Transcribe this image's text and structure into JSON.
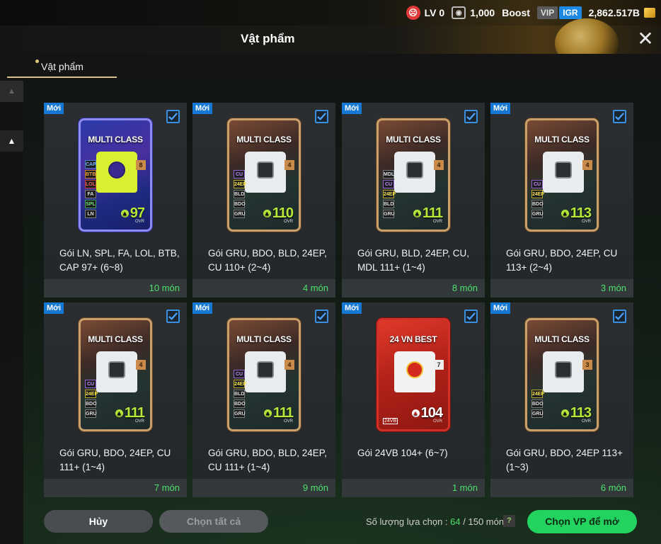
{
  "status_bar": {
    "level": "LV 0",
    "rank_points": "1,000",
    "boost_label": "Boost",
    "vip_label": "VIP",
    "igr_label": "IGR",
    "currency": "2,862.517B"
  },
  "header": {
    "title": "Vật phẩm"
  },
  "tabs": [
    {
      "label": "Vật phẩm",
      "active": true
    }
  ],
  "items": [
    {
      "badge": "Mới",
      "pack_style": "multi",
      "pack_title": "MULTI CLASS",
      "jersey_number": "8",
      "classes": [
        "CAP",
        "BTB",
        "LOL",
        "FA",
        "SPL",
        "LN"
      ],
      "ovr": "97",
      "ovr_label": "OVR",
      "name": "Gói LN, SPL, FA, LOL, BTB, CAP 97+ (6~8)",
      "count": "10 món",
      "checked": true
    },
    {
      "badge": "Mới",
      "pack_style": "mc",
      "pack_title": "MULTI CLASS",
      "jersey_number": "4",
      "classes": [
        "CU",
        "24EP",
        "BLD",
        "BDO",
        "GRU"
      ],
      "ovr": "110",
      "ovr_label": "OVR",
      "name": "Gói GRU, BDO, BLD, 24EP, CU 110+ (2~4)",
      "count": "4 món",
      "checked": true
    },
    {
      "badge": "Mới",
      "pack_style": "mc",
      "pack_title": "MULTI CLASS",
      "jersey_number": "4",
      "classes": [
        "MDL",
        "CU",
        "24EP",
        "BLD",
        "GRU"
      ],
      "ovr": "111",
      "ovr_label": "OVR",
      "name": "Gói GRU, BLD, 24EP, CU, MDL 111+ (1~4)",
      "count": "8 món",
      "checked": true
    },
    {
      "badge": "Mới",
      "pack_style": "mc",
      "pack_title": "MULTI CLASS",
      "jersey_number": "4",
      "classes": [
        "CU",
        "24EP",
        "BDO",
        "GRU"
      ],
      "ovr": "113",
      "ovr_label": "OVR",
      "name": "Gói GRU, BDO, 24EP, CU 113+ (2~4)",
      "count": "3 món",
      "checked": true
    },
    {
      "badge": "Mới",
      "pack_style": "mc",
      "pack_title": "MULTI CLASS",
      "jersey_number": "4",
      "classes": [
        "CU",
        "24EP",
        "BDO",
        "GRU"
      ],
      "ovr": "111",
      "ovr_label": "OVR",
      "name": "Gói GRU, BDO, 24EP, CU 111+ (1~4)",
      "count": "7 món",
      "checked": true
    },
    {
      "badge": "Mới",
      "pack_style": "mc",
      "pack_title": "MULTI CLASS",
      "jersey_number": "4",
      "classes": [
        "CU",
        "24EP",
        "BLD",
        "BDO",
        "GRU"
      ],
      "ovr": "111",
      "ovr_label": "OVR",
      "name": "Gói GRU, BDO, BLD, 24EP, CU 111+ (1~4)",
      "count": "9 món",
      "checked": true
    },
    {
      "badge": "Mới",
      "pack_style": "red",
      "pack_title": "24 VN BEST",
      "jersey_number": "7",
      "classes": [],
      "class_tag": "24VB",
      "ovr": "104",
      "ovr_label": "OVR",
      "name": "Gói 24VB 104+ (6~7)",
      "count": "1 món",
      "checked": true
    },
    {
      "badge": "Mới",
      "pack_style": "mc",
      "pack_title": "MULTI CLASS",
      "jersey_number": "3",
      "classes": [
        "24EP",
        "BDO",
        "GRU"
      ],
      "ovr": "113",
      "ovr_label": "OVR",
      "name": "Gói GRU, BDO, 24EP 113+ (1~3)",
      "count": "6 món",
      "checked": true
    }
  ],
  "footer": {
    "cancel_label": "Hủy",
    "select_all_label": "Chọn tất cả",
    "selection_label": "Số lượng lựa chọn :",
    "selected_count": "64",
    "selection_total": "/ 150 món",
    "help_label": "?",
    "open_label": "Chọn VP để mở"
  },
  "colors": {
    "new_badge": "#1478d4",
    "count_text": "#4ee06a",
    "open_button": "#23d35f",
    "ovr_green": "#b6e83a"
  }
}
